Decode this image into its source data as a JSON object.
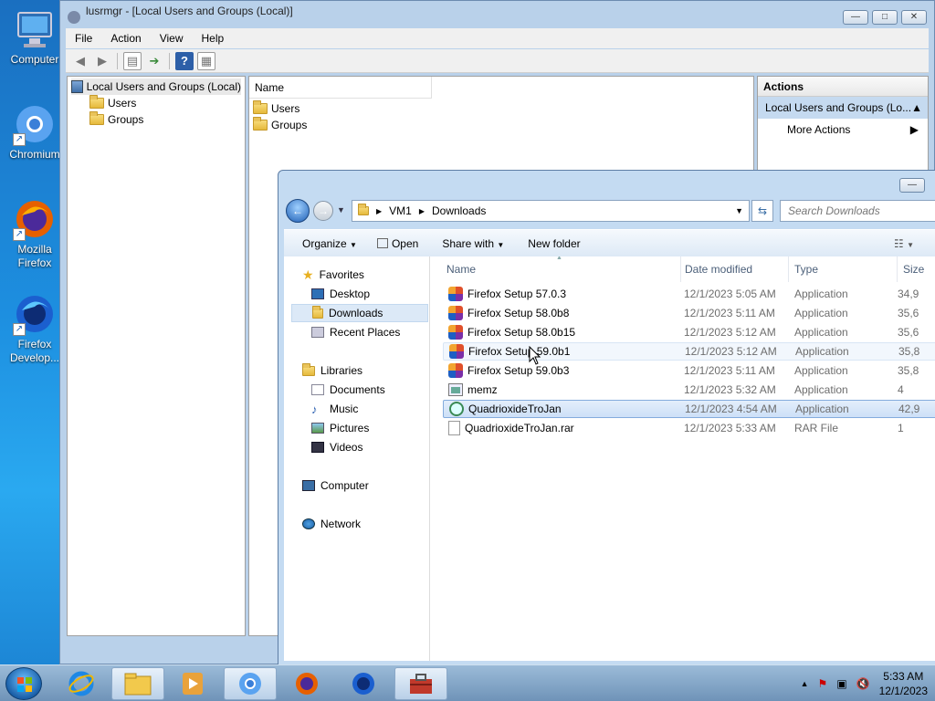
{
  "desktop": {
    "icons": [
      {
        "label": "Computer"
      },
      {
        "label": "Chromium"
      },
      {
        "label": "Mozilla Firefox"
      },
      {
        "label": "Firefox Develop..."
      }
    ]
  },
  "mmc": {
    "title": "lusrmgr - [Local Users and Groups (Local)]",
    "menu": [
      "File",
      "Action",
      "View",
      "Help"
    ],
    "tree": {
      "root": "Local Users and Groups (Local)",
      "children": [
        "Users",
        "Groups"
      ]
    },
    "list": {
      "header": "Name",
      "items": [
        "Users",
        "Groups"
      ]
    },
    "actions": {
      "header": "Actions",
      "selected": "Local Users and Groups (Lo...",
      "more": "More Actions"
    }
  },
  "explorer": {
    "breadcrumb": [
      "VM1",
      "Downloads"
    ],
    "search_placeholder": "Search Downloads",
    "commands": [
      "Organize",
      "Open",
      "Share with",
      "New folder"
    ],
    "nav": {
      "favorites": "Favorites",
      "desktop": "Desktop",
      "downloads": "Downloads",
      "recent": "Recent Places",
      "libraries": "Libraries",
      "documents": "Documents",
      "music": "Music",
      "pictures": "Pictures",
      "videos": "Videos",
      "computer": "Computer",
      "network": "Network"
    },
    "columns": {
      "name": "Name",
      "date": "Date modified",
      "type": "Type",
      "size": "Size"
    },
    "files": [
      {
        "name": "Firefox Setup 57.0.3",
        "date": "12/1/2023 5:05 AM",
        "type": "Application",
        "size": "34,9"
      },
      {
        "name": "Firefox Setup 58.0b8",
        "date": "12/1/2023 5:11 AM",
        "type": "Application",
        "size": "35,6"
      },
      {
        "name": "Firefox Setup 58.0b15",
        "date": "12/1/2023 5:12 AM",
        "type": "Application",
        "size": "35,6"
      },
      {
        "name": "Firefox Setup 59.0b1",
        "date": "12/1/2023 5:12 AM",
        "type": "Application",
        "size": "35,8"
      },
      {
        "name": "Firefox Setup 59.0b3",
        "date": "12/1/2023 5:11 AM",
        "type": "Application",
        "size": "35,8"
      },
      {
        "name": "memz",
        "date": "12/1/2023 5:32 AM",
        "type": "Application",
        "size": "4"
      },
      {
        "name": "QuadrioxideTroJan",
        "date": "12/1/2023 4:54 AM",
        "type": "Application",
        "size": "42,9"
      },
      {
        "name": "QuadrioxideTroJan.rar",
        "date": "12/1/2023 5:33 AM",
        "type": "RAR File",
        "size": "1"
      }
    ]
  },
  "taskbar": {
    "time": "5:33 AM",
    "date": "12/1/2023"
  }
}
